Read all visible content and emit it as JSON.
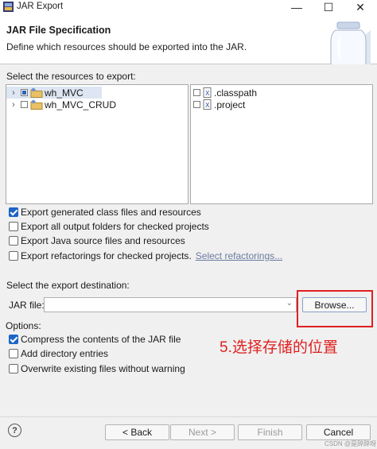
{
  "window": {
    "title": "JAR Export",
    "controls": {
      "minimize": "—",
      "maximize": "☐",
      "close": "✕"
    }
  },
  "header": {
    "title": "JAR File Specification",
    "description": "Define which resources should be exported into the JAR."
  },
  "resources": {
    "label": "Select the resources to export:",
    "projects": [
      {
        "name": "wh_MVC",
        "state": "partial",
        "selected": true
      },
      {
        "name": "wh_MVC_CRUD",
        "state": "unchecked",
        "selected": false
      }
    ],
    "files": [
      {
        "name": ".classpath",
        "checked": false
      },
      {
        "name": ".project",
        "checked": false
      }
    ]
  },
  "export_options": [
    {
      "label": "Export generated class files and resources",
      "checked": true
    },
    {
      "label": "Export all output folders for checked projects",
      "checked": false
    },
    {
      "label": "Export Java source files and resources",
      "checked": false
    },
    {
      "label": "Export refactorings for checked projects.",
      "checked": false,
      "link": "Select refactorings..."
    }
  ],
  "destination": {
    "label": "Select the export destination:",
    "jar_file_label": "JAR file:",
    "jar_file_value": "",
    "browse_label": "Browse..."
  },
  "annotation": {
    "text": "5.选择存储的位置",
    "color": "#e02020"
  },
  "options": {
    "label": "Options:",
    "items": [
      {
        "label": "Compress the contents of the JAR file",
        "checked": true
      },
      {
        "label": "Add directory entries",
        "checked": false
      },
      {
        "label": "Overwrite existing files without warning",
        "checked": false
      }
    ]
  },
  "footer": {
    "help_icon": "?",
    "back_label": "< Back",
    "next_label": "Next >",
    "finish_label": "Finish",
    "cancel_label": "Cancel",
    "watermark": "CSDN @是辞辞呀"
  }
}
